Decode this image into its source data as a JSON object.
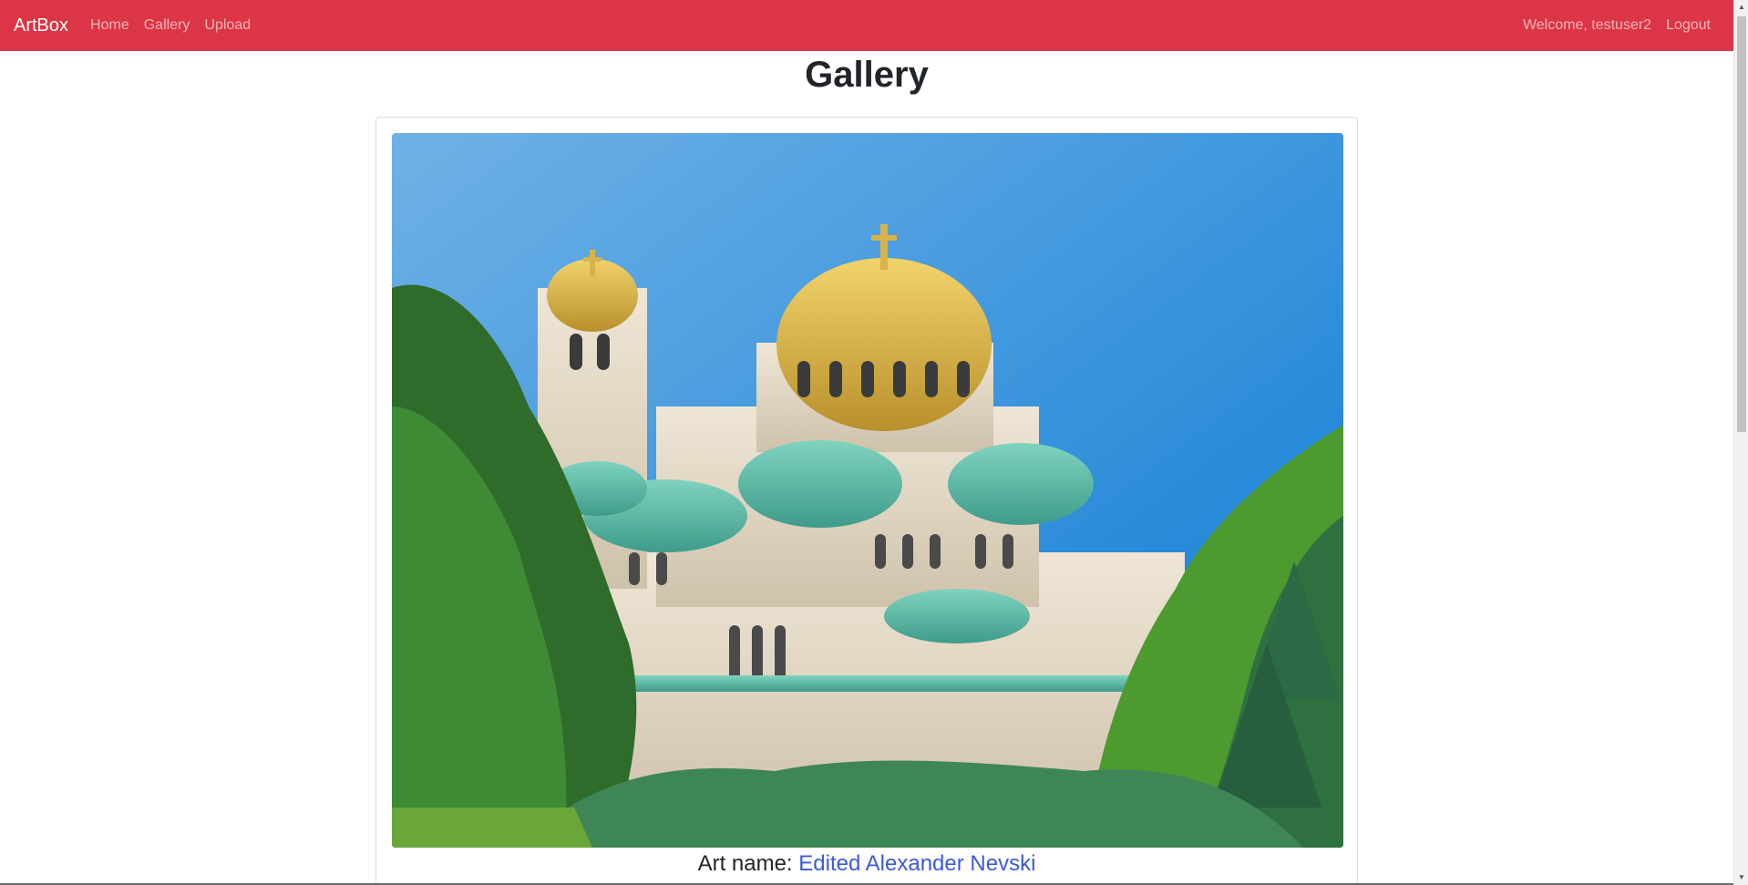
{
  "navbar": {
    "brand": "ArtBox",
    "links": [
      "Home",
      "Gallery",
      "Upload"
    ],
    "welcome": "Welcome, testuser2",
    "logout": "Logout",
    "color": "#dc3545"
  },
  "page": {
    "title": "Gallery"
  },
  "artwork": {
    "label": "Art name:",
    "name": "Edited Alexander Nevski",
    "link_color": "#3b5bdb"
  }
}
